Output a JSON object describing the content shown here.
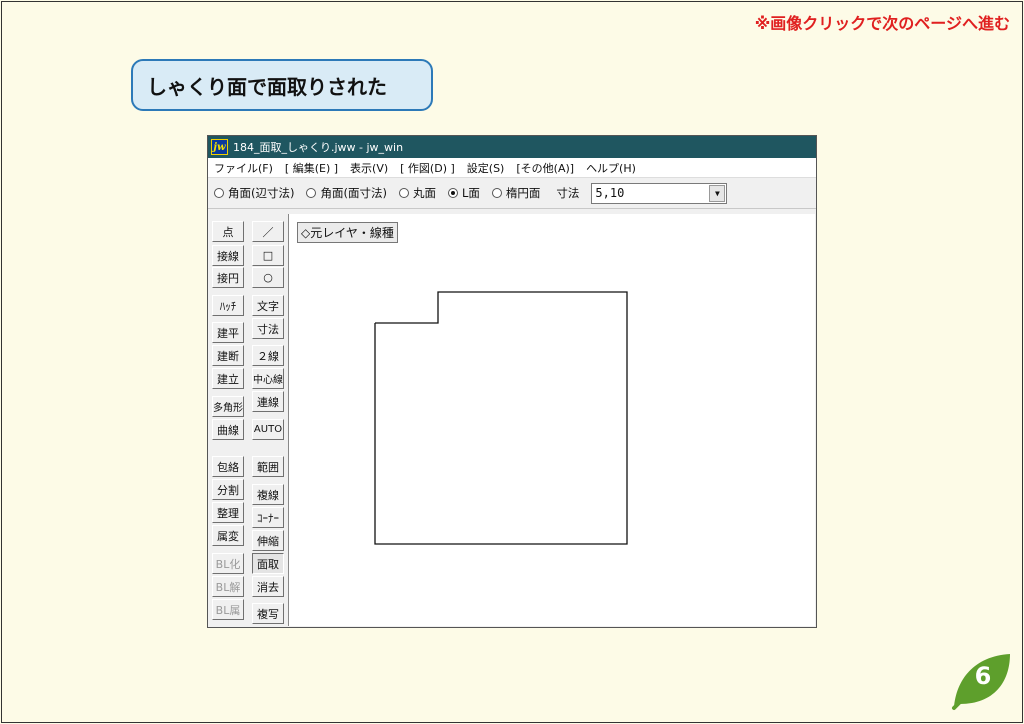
{
  "hint": "※画像クリックで次のページへ進む",
  "callout": "しゃくり面で面取りされた",
  "window": {
    "app_icon": "jw",
    "title": "184_面取_しゃくり.jww - jw_win",
    "menu": [
      "ファイル(F)",
      "[ 編集(E) ]",
      "表示(V)",
      "[ 作図(D) ]",
      "設定(S)",
      "[その他(A)]",
      "ヘルプ(H)"
    ],
    "options": [
      {
        "label": "角面(辺寸法)",
        "selected": false
      },
      {
        "label": "角面(面寸法)",
        "selected": false
      },
      {
        "label": "丸面",
        "selected": false
      },
      {
        "label": "L面",
        "selected": true
      },
      {
        "label": "楕円面",
        "selected": false
      }
    ],
    "dim_label": "寸法",
    "dim_value": "5,10",
    "left_tools": [
      "点",
      "接線",
      "接円",
      "ﾊｯﾁ",
      "建平",
      "建断",
      "建立",
      "多角形",
      "曲線",
      "包絡",
      "分割",
      "整理",
      "属変",
      "BL化",
      "BL解",
      "BL属"
    ],
    "left_disabled": [
      "BL化",
      "BL解",
      "BL属"
    ],
    "right_tools": [
      "／",
      "□",
      "○",
      "文字",
      "寸法",
      "２線",
      "中心線",
      "連線",
      "AUTO",
      "範囲",
      "複線",
      "ｺｰﾅｰ",
      "伸縮",
      "面取",
      "消去",
      "複写"
    ],
    "active_tool": "面取",
    "layer_label": "◇元レイヤ・線種"
  },
  "page_number": "6",
  "colors": {
    "background": "#fdfbe7",
    "hint_text": "#e02020",
    "callout_fill": "#d9ebf6",
    "callout_border": "#2c79b8",
    "titlebar": "#1f5660",
    "leaf_badge": "#5e9f2c"
  }
}
